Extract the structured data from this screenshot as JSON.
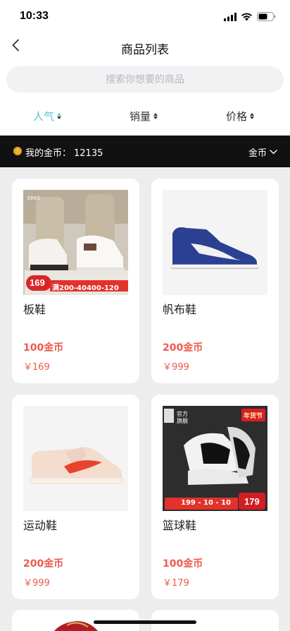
{
  "status_bar": {
    "time": "10:33"
  },
  "nav": {
    "title": "商品列表"
  },
  "search": {
    "placeholder": "搜索你想要的商品"
  },
  "sort": {
    "items": [
      {
        "label": "人气",
        "active": true
      },
      {
        "label": "销量",
        "active": false
      },
      {
        "label": "价格",
        "active": false
      }
    ]
  },
  "coins": {
    "label": "我的金币：",
    "value": "12135",
    "dropdown": "金币"
  },
  "products": [
    {
      "name": "板鞋",
      "coin_price": "100金币",
      "price": "￥169"
    },
    {
      "name": "帆布鞋",
      "coin_price": "200金币",
      "price": "￥999"
    },
    {
      "name": "运动鞋",
      "coin_price": "200金币",
      "price": "￥999"
    },
    {
      "name": "篮球鞋",
      "coin_price": "100金币",
      "price": "￥179"
    }
  ],
  "image_text": {
    "p1_price": "169",
    "p1_promo": "满200-40400-120",
    "p4_brand": "官方旗舰",
    "p4_prices": "199 - 10 - 10",
    "p4_final": "179",
    "p4_stamp": "年货节"
  },
  "colors": {
    "accent": "#52c6d6",
    "price": "#ef5a4e",
    "coin_bar": "#111111"
  }
}
